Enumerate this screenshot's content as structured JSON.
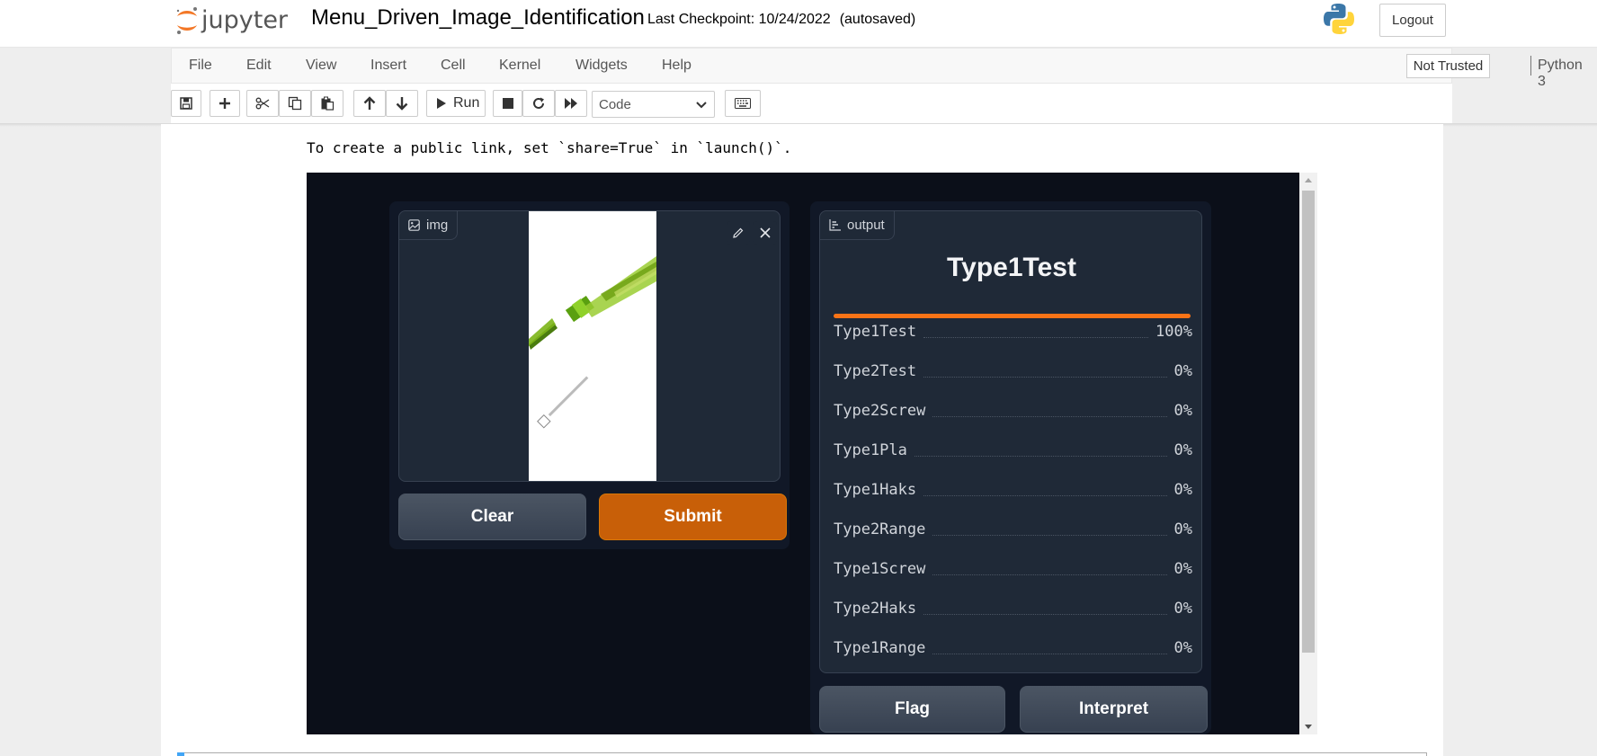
{
  "header": {
    "logo_text": "jupyter",
    "notebook_name": "Menu_Driven_Image_Identification",
    "checkpoint": "Last Checkpoint: 10/24/2022",
    "autosave": "(autosaved)",
    "logout_label": "Logout"
  },
  "menubar": {
    "items": [
      "File",
      "Edit",
      "View",
      "Insert",
      "Cell",
      "Kernel",
      "Widgets",
      "Help"
    ],
    "trust_label": "Not Trusted",
    "kernel_name": "Python 3"
  },
  "toolbar": {
    "run_label": "Run",
    "cell_type": "Code"
  },
  "output_text": "To create a public link, set `share=True` in `launch()`.",
  "gradio": {
    "input": {
      "label": "img",
      "clear_label": "Clear",
      "submit_label": "Submit"
    },
    "output": {
      "label": "output",
      "predicted": "Type1Test",
      "top_confidence": 1.0,
      "confidences": [
        {
          "name": "Type1Test",
          "value": "100%"
        },
        {
          "name": "Type2Test",
          "value": "0%"
        },
        {
          "name": "Type2Screw",
          "value": "0%"
        },
        {
          "name": "Type1Pla",
          "value": "0%"
        },
        {
          "name": "Type1Haks",
          "value": "0%"
        },
        {
          "name": "Type2Range",
          "value": "0%"
        },
        {
          "name": "Type1Screw",
          "value": "0%"
        },
        {
          "name": "Type2Haks",
          "value": "0%"
        },
        {
          "name": "Type1Range",
          "value": "0%"
        }
      ],
      "flag_label": "Flag",
      "interpret_label": "Interpret"
    }
  },
  "colors": {
    "primary_button": "#c85f08",
    "confidence_bar": "#f97316",
    "gradio_background": "#0b0f19"
  }
}
